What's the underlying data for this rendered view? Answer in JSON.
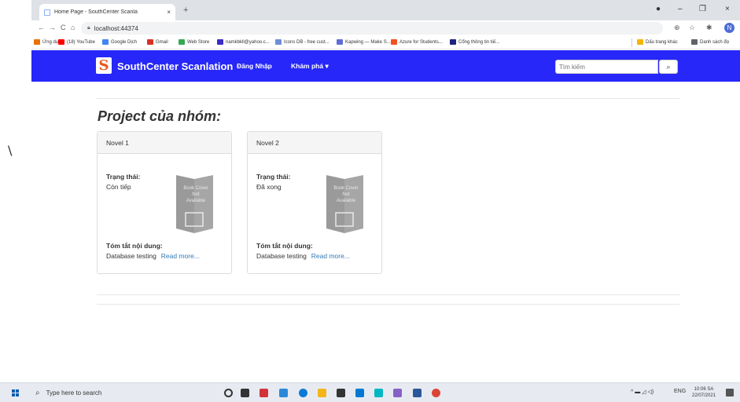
{
  "left_strip": {
    "glyph": "\\"
  },
  "browser": {
    "tab": {
      "title": "Home Page - SouthCenter Scanla",
      "close": "×"
    },
    "new_tab": "+",
    "window_controls": {
      "minimize": "–",
      "restore": "❐",
      "close": "×"
    },
    "nav": {
      "back": "←",
      "forward": "→",
      "reload": "C",
      "home": "⌂"
    },
    "address": "localhost:44374",
    "profile_initial": "N",
    "bookmarks": [
      {
        "label": "Ứng dụng",
        "color": "#e8710a"
      },
      {
        "label": "(18) YouTube",
        "color": "#ff0000"
      },
      {
        "label": "Google Dịch",
        "color": "#4285f4"
      },
      {
        "label": "Gmail",
        "color": "#d93025"
      },
      {
        "label": "Web Store",
        "color": "#34a853"
      },
      {
        "label": "namkbkll@yahoo.c...",
        "color": "#3b2cc9"
      },
      {
        "label": "Icons DB - free cust...",
        "color": "#6d8fd6"
      },
      {
        "label": "Kapwing — Make S...",
        "color": "#5f6cd8"
      },
      {
        "label": "Azure for Students...",
        "color": "#f25022"
      },
      {
        "label": "Cổng thông tin tiế...",
        "color": "#1a237e"
      }
    ],
    "bookmarks_right": [
      {
        "label": "Dấu trang khác",
        "color": "#f4b400"
      },
      {
        "label": "Danh sách đọ",
        "color": "#5f6368"
      }
    ]
  },
  "site": {
    "brand": "SouthCenter Scanlation",
    "logo_letter": "S",
    "nav_login": "Đăng Nhập",
    "nav_explore": "Khám phá ▾",
    "search_placeholder": "Tìm kiếm",
    "search_button": "⌕",
    "section_title": "Project của nhóm:",
    "cover_text": [
      "Book Cover",
      "Not",
      "Available"
    ],
    "projects": [
      {
        "name": "Novel 1",
        "status_label": "Trạng thái:",
        "status": "Còn tiếp",
        "summary_label": "Tóm tắt nội dung:",
        "summary": "Database testing",
        "read_more": "Read more..."
      },
      {
        "name": "Novel 2",
        "status_label": "Trạng thái:",
        "status": "Đã xong",
        "summary_label": "Tóm tắt nội dung:",
        "summary": "Database testing",
        "read_more": "Read more..."
      }
    ]
  },
  "taskbar": {
    "search_placeholder": "Type here to search",
    "apps": [
      {
        "name": "cortana",
        "color": "#333333"
      },
      {
        "name": "task-view",
        "color": "#333333"
      },
      {
        "name": "app-red",
        "color": "#d13438"
      },
      {
        "name": "app-blue",
        "color": "#2b88d8"
      },
      {
        "name": "edge",
        "color": "#0a7bd4"
      },
      {
        "name": "file-explorer",
        "color": "#f2b51b"
      },
      {
        "name": "store",
        "color": "#333333"
      },
      {
        "name": "mail",
        "color": "#0078d4"
      },
      {
        "name": "app-cyan",
        "color": "#00b7c3"
      },
      {
        "name": "visual-studio",
        "color": "#8661c5"
      },
      {
        "name": "word",
        "color": "#2b579a"
      },
      {
        "name": "chrome",
        "color": "#db4437"
      }
    ],
    "tray_icons": "^ ▬ ◿ ◁)",
    "language": "ENG",
    "time": "10:06 SA",
    "date": "22/07/2021"
  }
}
